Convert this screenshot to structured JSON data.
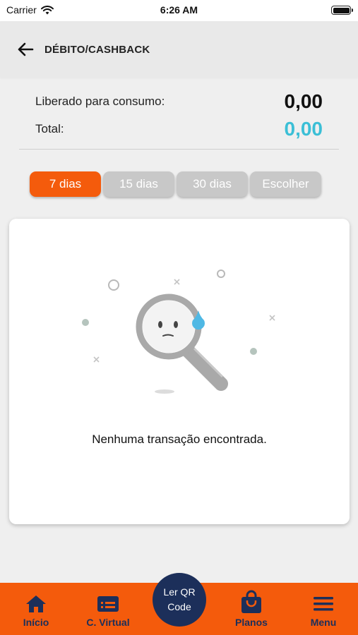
{
  "status_bar": {
    "carrier": "Carrier",
    "time": "6:26 AM"
  },
  "header": {
    "title": "DÉBITO/CASHBACK",
    "back_icon": "arrow-left-icon"
  },
  "balances": {
    "available_label": "Liberado para consumo:",
    "available_value": "0,00",
    "total_label": "Total:",
    "total_value": "0,00",
    "total_color": "#3bbfd6"
  },
  "filters": {
    "tabs": [
      {
        "label": "7 dias",
        "active": true
      },
      {
        "label": "15 dias",
        "active": false
      },
      {
        "label": "30 dias",
        "active": false
      },
      {
        "label": "Escolher",
        "active": false
      }
    ]
  },
  "empty_state": {
    "message": "Nenhuma transação encontrada.",
    "icon": "magnifier-sad-icon"
  },
  "bottom_nav": {
    "items": [
      {
        "label": "Início",
        "icon": "home-icon"
      },
      {
        "label": "C. Virtual",
        "icon": "card-icon"
      },
      {
        "label": "Planos",
        "icon": "shopping-bag-icon"
      },
      {
        "label": "Menu",
        "icon": "hamburger-icon"
      }
    ],
    "qr": {
      "line1": "Ler QR",
      "line2": "Code"
    }
  },
  "colors": {
    "accent": "#f45b0c",
    "navy": "#1c2f5a",
    "inactive_tab": "#c8c8c8"
  }
}
